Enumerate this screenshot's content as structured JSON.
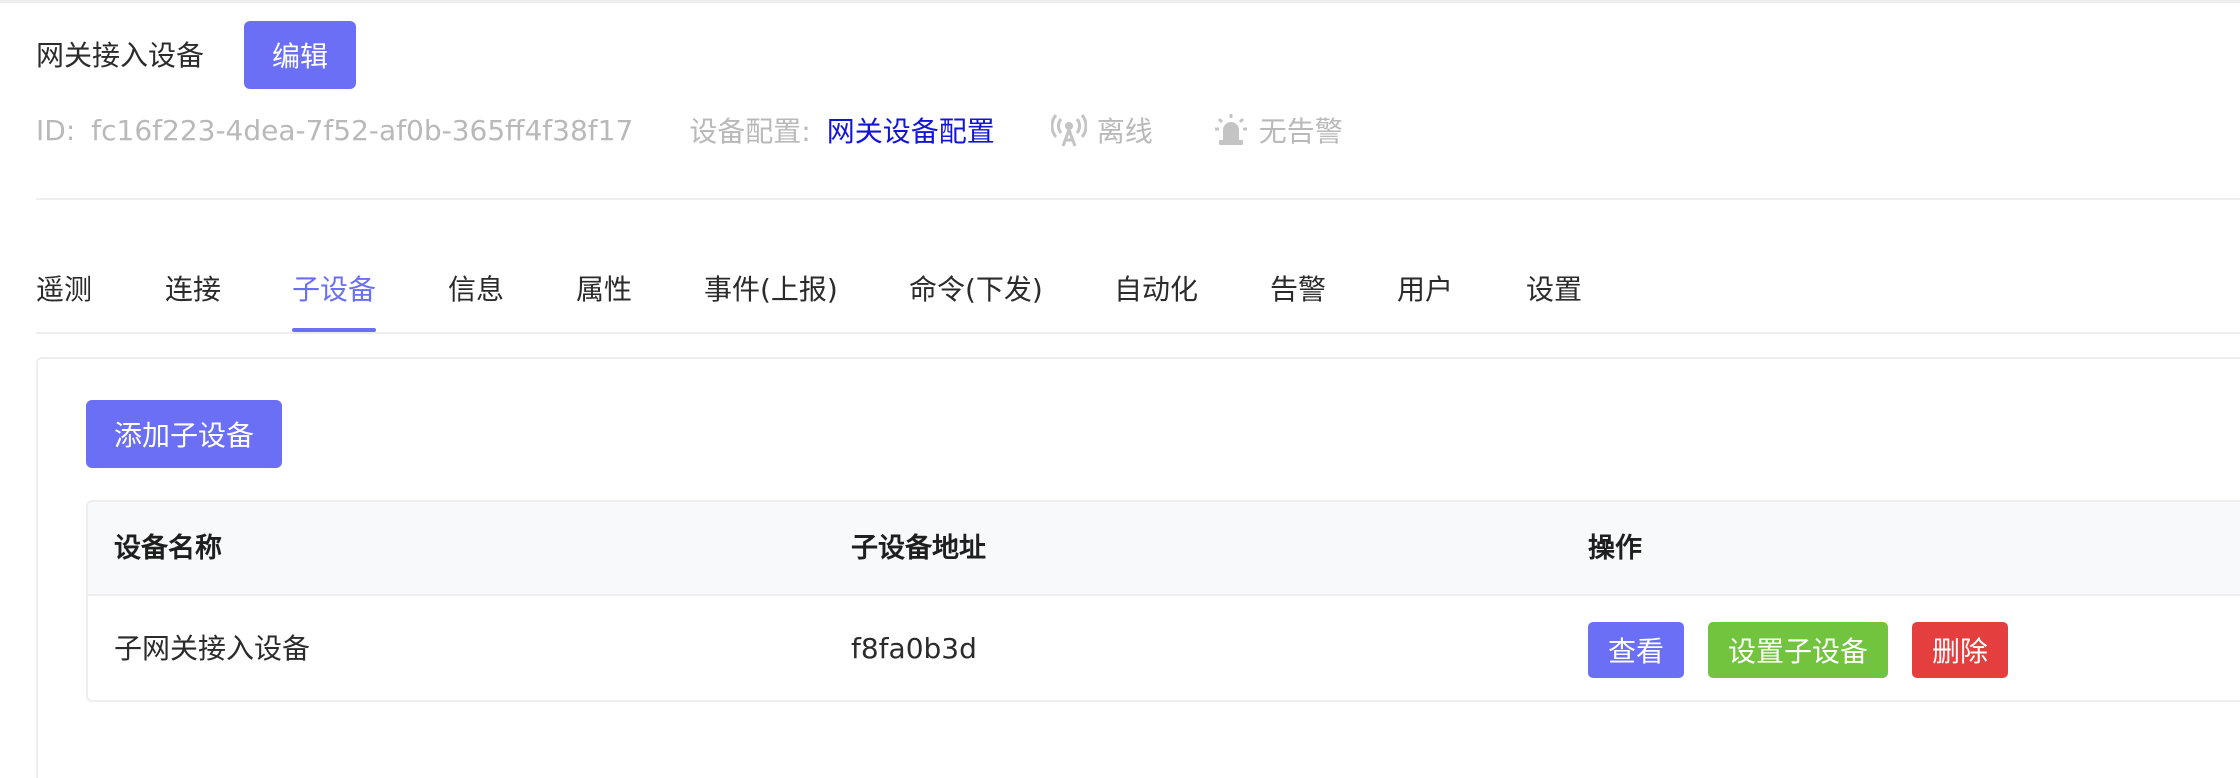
{
  "header": {
    "title": "网关接入设备",
    "edit_label": "编辑"
  },
  "meta": {
    "id_label": "ID:",
    "id_value": "fc16f223-4dea-7f52-af0b-365ff4f38f17",
    "config_label": "设备配置:",
    "config_value": "网关设备配置",
    "status_offline": "离线",
    "status_alarm": "无告警",
    "status_color": "#b9b9b9",
    "link_color": "#1414d8",
    "icons": [
      "antenna-icon",
      "alarm-siren-icon"
    ]
  },
  "tabs": [
    {
      "label": "遥测"
    },
    {
      "label": "连接"
    },
    {
      "label": "子设备",
      "active": true
    },
    {
      "label": "信息"
    },
    {
      "label": "属性"
    },
    {
      "label": "事件(上报)"
    },
    {
      "label": "命令(下发)"
    },
    {
      "label": "自动化"
    },
    {
      "label": "告警"
    },
    {
      "label": "用户"
    },
    {
      "label": "设置"
    }
  ],
  "subdevices": {
    "add_label": "添加子设备",
    "columns": [
      "设备名称",
      "子设备地址",
      "操作"
    ],
    "rows": [
      {
        "name": "子网关接入设备",
        "address": "f8fa0b3d",
        "actions": [
          "查看",
          "设置子设备",
          "删除"
        ]
      }
    ]
  },
  "colors": {
    "primary": "#6b6ff5",
    "success": "#72c43f",
    "danger": "#e53e3e"
  }
}
